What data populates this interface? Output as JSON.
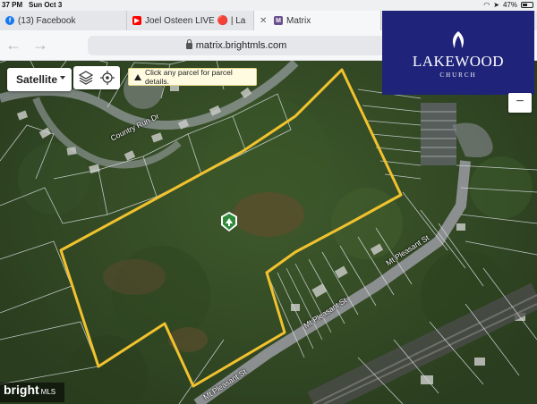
{
  "status": {
    "time": "37 PM",
    "date": "Sun Oct 3",
    "battery": "47%",
    "battery_level": 0.47
  },
  "tabs": [
    {
      "label": "(13) Facebook",
      "icon": "facebook-icon",
      "color": "#1877f2"
    },
    {
      "label": "Joel Osteen LIVE 🔴 | La",
      "icon": "youtube-icon",
      "color": "#ff0000"
    },
    {
      "label": "Matrix",
      "icon": "matrix-icon",
      "color": "#6b4e8e"
    }
  ],
  "address": {
    "url": "matrix.brightmls.com"
  },
  "map_controls": {
    "map_type": "Satellite",
    "hint": "Click any parcel for parcel details.",
    "zoom_out": "−"
  },
  "video_overlay": {
    "title": "LAKEWOOD",
    "subtitle": "CHURCH",
    "bg_color": "#1f237a"
  },
  "roads": {
    "country_run": "Country Run Dr",
    "mt_pleasant_1": "Mt Pleasant St",
    "mt_pleasant_2": "Mt Pleasant St",
    "mt_pleasant_3": "Mt Pleasant St"
  },
  "watermark": {
    "main": "bright",
    "sub": "MLS"
  },
  "colors": {
    "parcel_outline": "#f2c22e",
    "parcel_lines": "#d9dde0"
  }
}
